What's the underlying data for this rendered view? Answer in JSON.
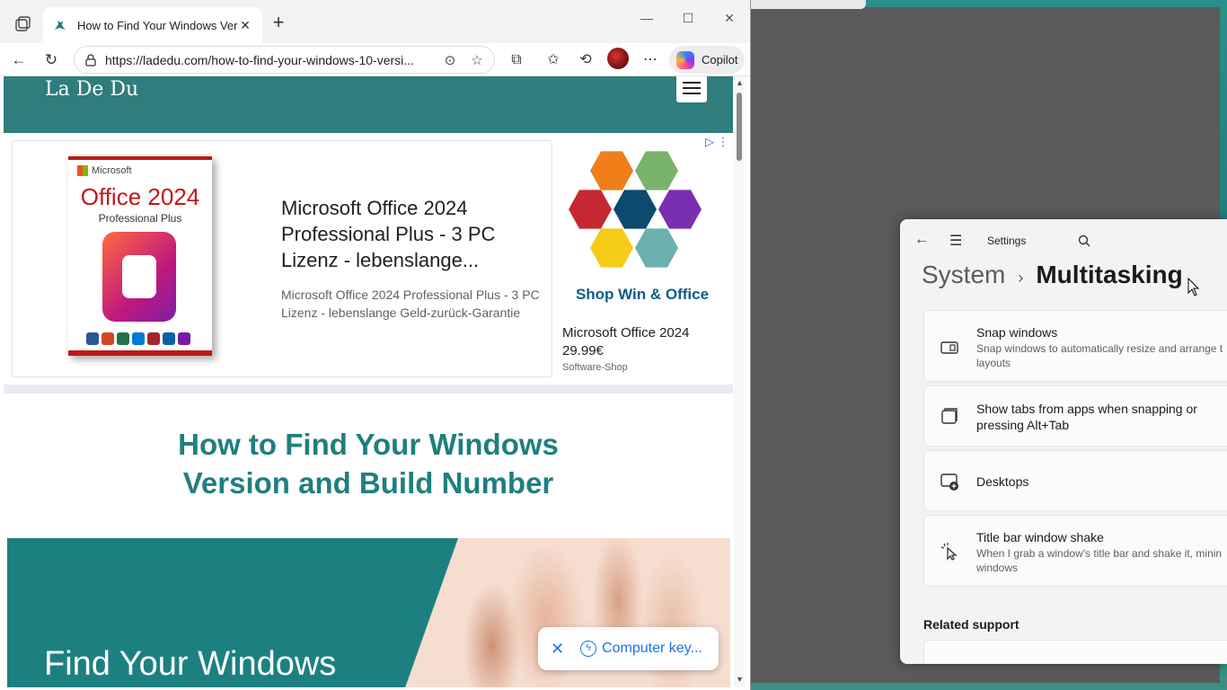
{
  "browser": {
    "tab_title": "How to Find Your Windows Versio",
    "url": "https://ladedu.com/how-to-find-your-windows-10-versi...",
    "copilot_label": "Copilot"
  },
  "site": {
    "logo": "La De Du"
  },
  "ad": {
    "box_brand": "Microsoft",
    "box_product": "Office 2024",
    "box_edition": "Professional Plus",
    "title": "Microsoft Office 2024 Professional Plus - 3 PC Lizenz - lebenslange...",
    "description": "Microsoft Office 2024 Professional Plus - 3 PC Lizenz - lebenslange Geld-zurück-Garantie",
    "shop_name": "Shop Win & Office",
    "side_title": "Microsoft Office 2024",
    "side_price": "29.99€",
    "side_seller": "Software-Shop"
  },
  "article": {
    "title": "How to Find Your Windows Version and Build Number",
    "hero_text": "Find Your Windows"
  },
  "toast": {
    "label": "Computer key..."
  },
  "settings": {
    "app_title": "Settings",
    "breadcrumb_parent": "System",
    "breadcrumb_current": "Multitasking",
    "items": [
      {
        "title": "Snap windows",
        "desc_line1": "Snap windows to automatically resize and arrange t",
        "desc_line2": "layouts"
      },
      {
        "title": "Show tabs from apps when snapping or",
        "title_line2": "pressing Alt+Tab"
      },
      {
        "title": "Desktops"
      },
      {
        "title": "Title bar window shake",
        "desc_line1": "When I grab a window's title bar and shake it, minin",
        "desc_line2": "windows"
      }
    ],
    "related_support": "Related support"
  },
  "colors": {
    "site_teal": "#2f7d7d",
    "title_teal": "#1f7f7f",
    "link_blue": "#1a73e8"
  }
}
